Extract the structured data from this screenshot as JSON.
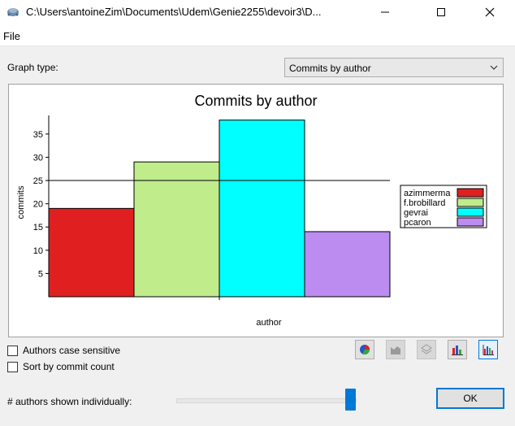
{
  "window": {
    "title": "C:\\Users\\antoineZim\\Documents\\Udem\\Genie2255\\devoir3\\D...",
    "minimize_icon": "minimize-icon",
    "maximize_icon": "maximize-icon",
    "close_icon": "close-icon"
  },
  "menu": {
    "file": "File"
  },
  "graph_type": {
    "label": "Graph type:",
    "selected": "Commits by author"
  },
  "chart_data": {
    "type": "bar",
    "title": "Commits by author",
    "xlabel": "author",
    "ylabel": "commits",
    "categories": [
      "azimmerma",
      "f.brobillard",
      "gevrai",
      "pcaron"
    ],
    "values": [
      19,
      29,
      38,
      14
    ],
    "colors": [
      "#e02020",
      "#c0ec8c",
      "#00ffff",
      "#bc8cf0"
    ],
    "yticks": [
      5,
      10,
      15,
      20,
      25,
      30,
      35
    ],
    "ylim": [
      0,
      39
    ],
    "reference_line": 25,
    "legend": {
      "position": "right",
      "entries": [
        "azimmerma",
        "f.brobillard",
        "gevrai",
        "pcaron"
      ]
    }
  },
  "options": {
    "case_sensitive": {
      "label": "Authors case sensitive",
      "checked": false
    },
    "sort_by_count": {
      "label": "Sort by commit count",
      "checked": false
    }
  },
  "chart_type_buttons": [
    {
      "icon": "pie-chart-icon",
      "state": "enabled"
    },
    {
      "icon": "area-chart-icon",
      "state": "disabled"
    },
    {
      "icon": "layered-chart-icon",
      "state": "disabled"
    },
    {
      "icon": "bar-chart-icon",
      "state": "enabled"
    },
    {
      "icon": "histogram-icon",
      "state": "selected"
    }
  ],
  "authors_shown": {
    "label": "# authors shown individually:",
    "slider_fraction": 1.0
  },
  "ok_button": {
    "label": "OK"
  }
}
